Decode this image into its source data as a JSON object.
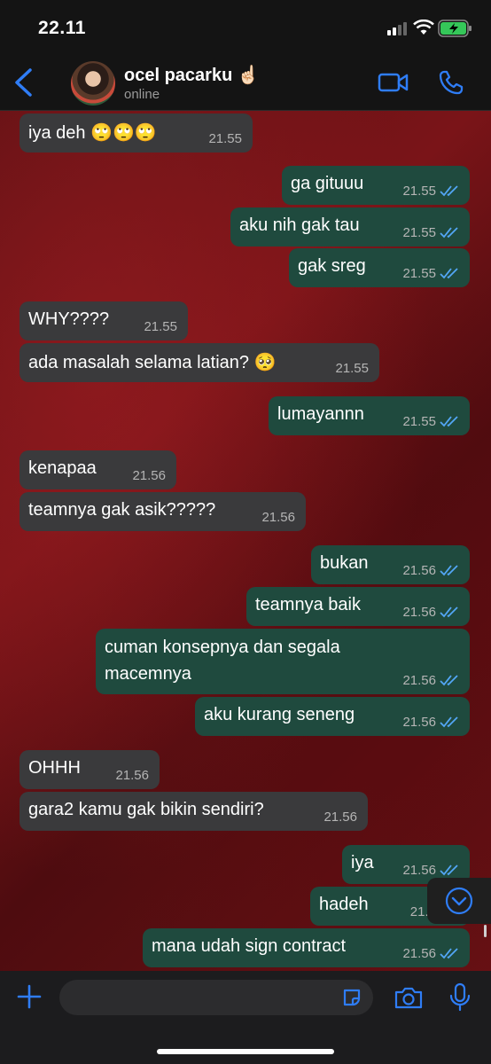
{
  "status_bar": {
    "time": "22.11"
  },
  "header": {
    "contact_name": "ocel pacarku ☝🏻",
    "status": "online"
  },
  "messages": [
    {
      "text": "iya deh 🙄🙄🙄",
      "time": "21.55"
    },
    {
      "text": "ga gituuu",
      "time": "21.55"
    },
    {
      "text": "aku nih gak tau",
      "time": "21.55"
    },
    {
      "text": "gak sreg",
      "time": "21.55"
    },
    {
      "text": "WHY????",
      "time": "21.55"
    },
    {
      "text": "ada masalah selama latian? 🥺",
      "time": "21.55"
    },
    {
      "text": "lumayannn",
      "time": "21.55"
    },
    {
      "text": "kenapaa",
      "time": "21.56"
    },
    {
      "text": "teamnya gak asik?????",
      "time": "21.56"
    },
    {
      "text": "bukan",
      "time": "21.56"
    },
    {
      "text": "teamnya baik",
      "time": "21.56"
    },
    {
      "text": "cuman konsepnya dan segala macemnya",
      "time": "21.56"
    },
    {
      "text": "aku kurang seneng",
      "time": "21.56"
    },
    {
      "text": "OHHH",
      "time": "21.56"
    },
    {
      "text": "gara2 kamu gak bikin sendiri?",
      "time": "21.56"
    },
    {
      "text": "iya",
      "time": "21.56"
    },
    {
      "text": "hadeh",
      "time": "21.5"
    },
    {
      "text": "mana udah sign contract",
      "time": "21.56"
    }
  ],
  "colors": {
    "accent": "#2f7df6",
    "read_ticks": "#53a6f5",
    "outgoing": "#1f4a3e",
    "incoming": "#3a3a3c"
  }
}
